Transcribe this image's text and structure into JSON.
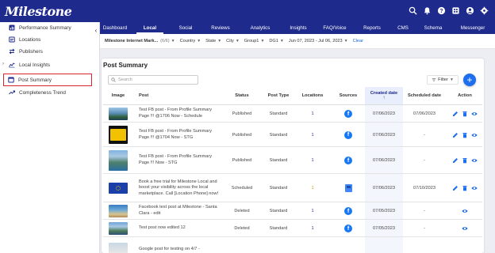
{
  "app": {
    "logo": "Milestone"
  },
  "sidebar": {
    "items": [
      {
        "label": "Performance Summary",
        "icon": "chart-icon"
      },
      {
        "label": "Locations",
        "icon": "location-icon"
      },
      {
        "label": "Publishers",
        "icon": "swap-icon"
      },
      {
        "label": "Local Insights",
        "icon": "insights-icon"
      },
      {
        "label": "Post Summary",
        "icon": "post-icon",
        "active": true
      },
      {
        "label": "Completeness Trend",
        "icon": "trend-icon"
      }
    ]
  },
  "nav": {
    "tabs": [
      "Dashboard",
      "Local",
      "Social",
      "Reviews",
      "Analytics",
      "Insights",
      "FAQ/Voice",
      "Reports",
      "CMS",
      "Schema",
      "Messenger"
    ],
    "active": "Local"
  },
  "filters": {
    "account": "Milestone Internet Mark...",
    "account_count": "(6/6)",
    "country": "Country",
    "state": "State",
    "city": "City",
    "group": "Group1",
    "dg": "DG1",
    "date_range": "Jun 07, 2023 - Jul 06, 2023",
    "clear": "Clear"
  },
  "post_summary": {
    "title": "Post Summary",
    "search_placeholder": "Search",
    "filter_label": "Filter",
    "columns": {
      "image": "Image",
      "post": "Post",
      "status": "Status",
      "post_type": "Post Type",
      "locations": "Locations",
      "sources": "Sources",
      "created_date": "Created date",
      "scheduled_date": "Scheduled date",
      "action": "Action"
    },
    "rows": [
      {
        "post": "Test FB post - From Profile Summary Page !!! @1706 Now - Schedule",
        "status": "Published",
        "post_type": "Standard",
        "locations": "1",
        "source": "facebook",
        "created": "07/06/2023",
        "scheduled": "07/06/2023",
        "thumb": "lake"
      },
      {
        "post": "Test FB post - From Profile Summary Page !!! @1704 Now - STG",
        "status": "Published",
        "post_type": "Standard",
        "locations": "1",
        "source": "facebook",
        "created": "07/06/2023",
        "scheduled": "-",
        "thumb": "loot"
      },
      {
        "post": "Test FB post - From Profile Summary Page !!! Now - STG",
        "status": "Published",
        "post_type": "Standard",
        "locations": "1",
        "source": "facebook",
        "created": "07/06/2023",
        "scheduled": "-",
        "thumb": "mountain"
      },
      {
        "post": "Book a free trial for Milestone Local and boost your visibility across the local marketplace. Call [Location Phone] now!",
        "status": "Scheduled",
        "post_type": "Standard",
        "locations": "1",
        "source": "google",
        "created": "07/06/2023",
        "scheduled": "07/10/2023",
        "thumb": "eu"
      },
      {
        "post": "Facebook test post at Milestone - Santa Clara - edit",
        "status": "Deleted",
        "post_type": "Standard",
        "locations": "1",
        "source": "facebook",
        "created": "07/05/2023",
        "scheduled": "-",
        "thumb": "beach"
      },
      {
        "post": "Test post now edited 12",
        "status": "Deleted",
        "post_type": "Standard",
        "locations": "1",
        "source": "facebook",
        "created": "07/05/2023",
        "scheduled": "-",
        "thumb": "mountain2"
      },
      {
        "post": "Google post for testing on 4/7 -",
        "status": "",
        "post_type": "",
        "locations": "",
        "source": "",
        "created": "",
        "scheduled": "",
        "thumb": "last"
      }
    ]
  },
  "colors": {
    "brand": "#1e2a8c",
    "accent": "#1e6ef0",
    "active_border": "#d9242b"
  }
}
